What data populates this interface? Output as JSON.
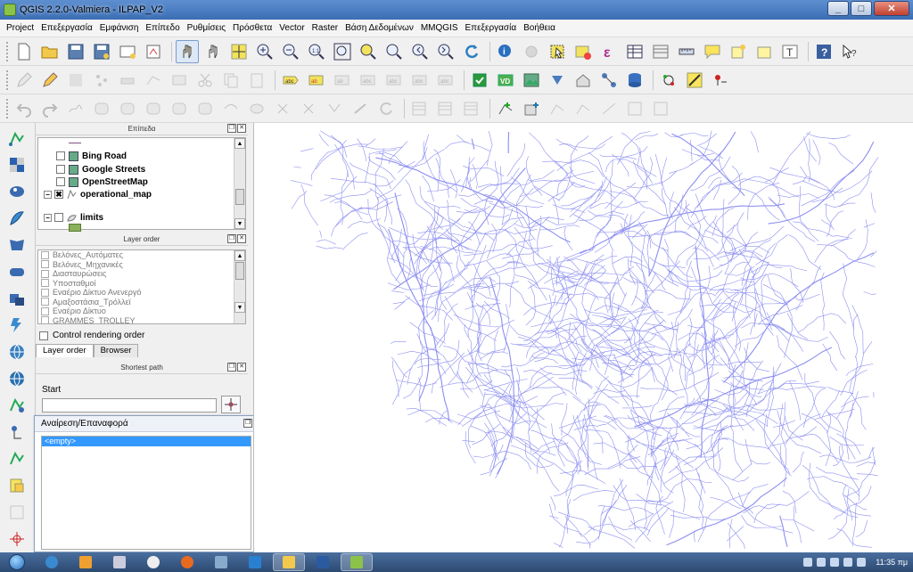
{
  "window": {
    "title": "QGIS 2.2.0-Valmiera - ILPAP_V2",
    "minimize": "_",
    "maximize": "□",
    "close": "✕"
  },
  "menubar": [
    "Project",
    "Επεξεργασία",
    "Εμφάνιση",
    "Επίπεδο",
    "Ρυθμίσεις",
    "Πρόσθετα",
    "Vector",
    "Raster",
    "Βάση Δεδομένων",
    "MMQGIS",
    "Επεξεργασία",
    "Βοήθεια"
  ],
  "layers_panel": {
    "title": "Επίπεδα",
    "layers": [
      {
        "name": "Bing Road",
        "checked": false
      },
      {
        "name": "Google Streets",
        "checked": false
      },
      {
        "name": "OpenStreetMap",
        "checked": false
      },
      {
        "name": "operational_map",
        "checked": true
      },
      {
        "name": "limits",
        "checked": false
      }
    ]
  },
  "layer_order_panel": {
    "title": "Layer order",
    "items": [
      "Βελόνες_Αυτόματες",
      "Βελόνες_Μηχανικές",
      "Διασταυρώσεις",
      "Υποσταθμοί",
      "Εναέριο Δίκτυο Ανενεργό",
      "Αμαξοστάσια_Τρόλλεϊ",
      "Εναέριο Δίκτυο",
      "GRAMMES_TROLLEY"
    ],
    "control_rendering_order": "Control rendering order"
  },
  "tabs": [
    {
      "label": "Layer order",
      "active": true
    },
    {
      "label": "Browser",
      "active": false
    }
  ],
  "shortest_path_panel": {
    "title": "Shortest path",
    "start_label": "Start",
    "start_value": ""
  },
  "undo_panel": {
    "title": "Αναίρεση/Επαναφορά",
    "items": [
      "<empty>"
    ]
  },
  "taskbar": {
    "clock": "11:35 πμ"
  },
  "colors": {
    "map_lines": "#8c8ef0",
    "title_bar": "#4a7cc0",
    "selection": "#3399ff"
  }
}
